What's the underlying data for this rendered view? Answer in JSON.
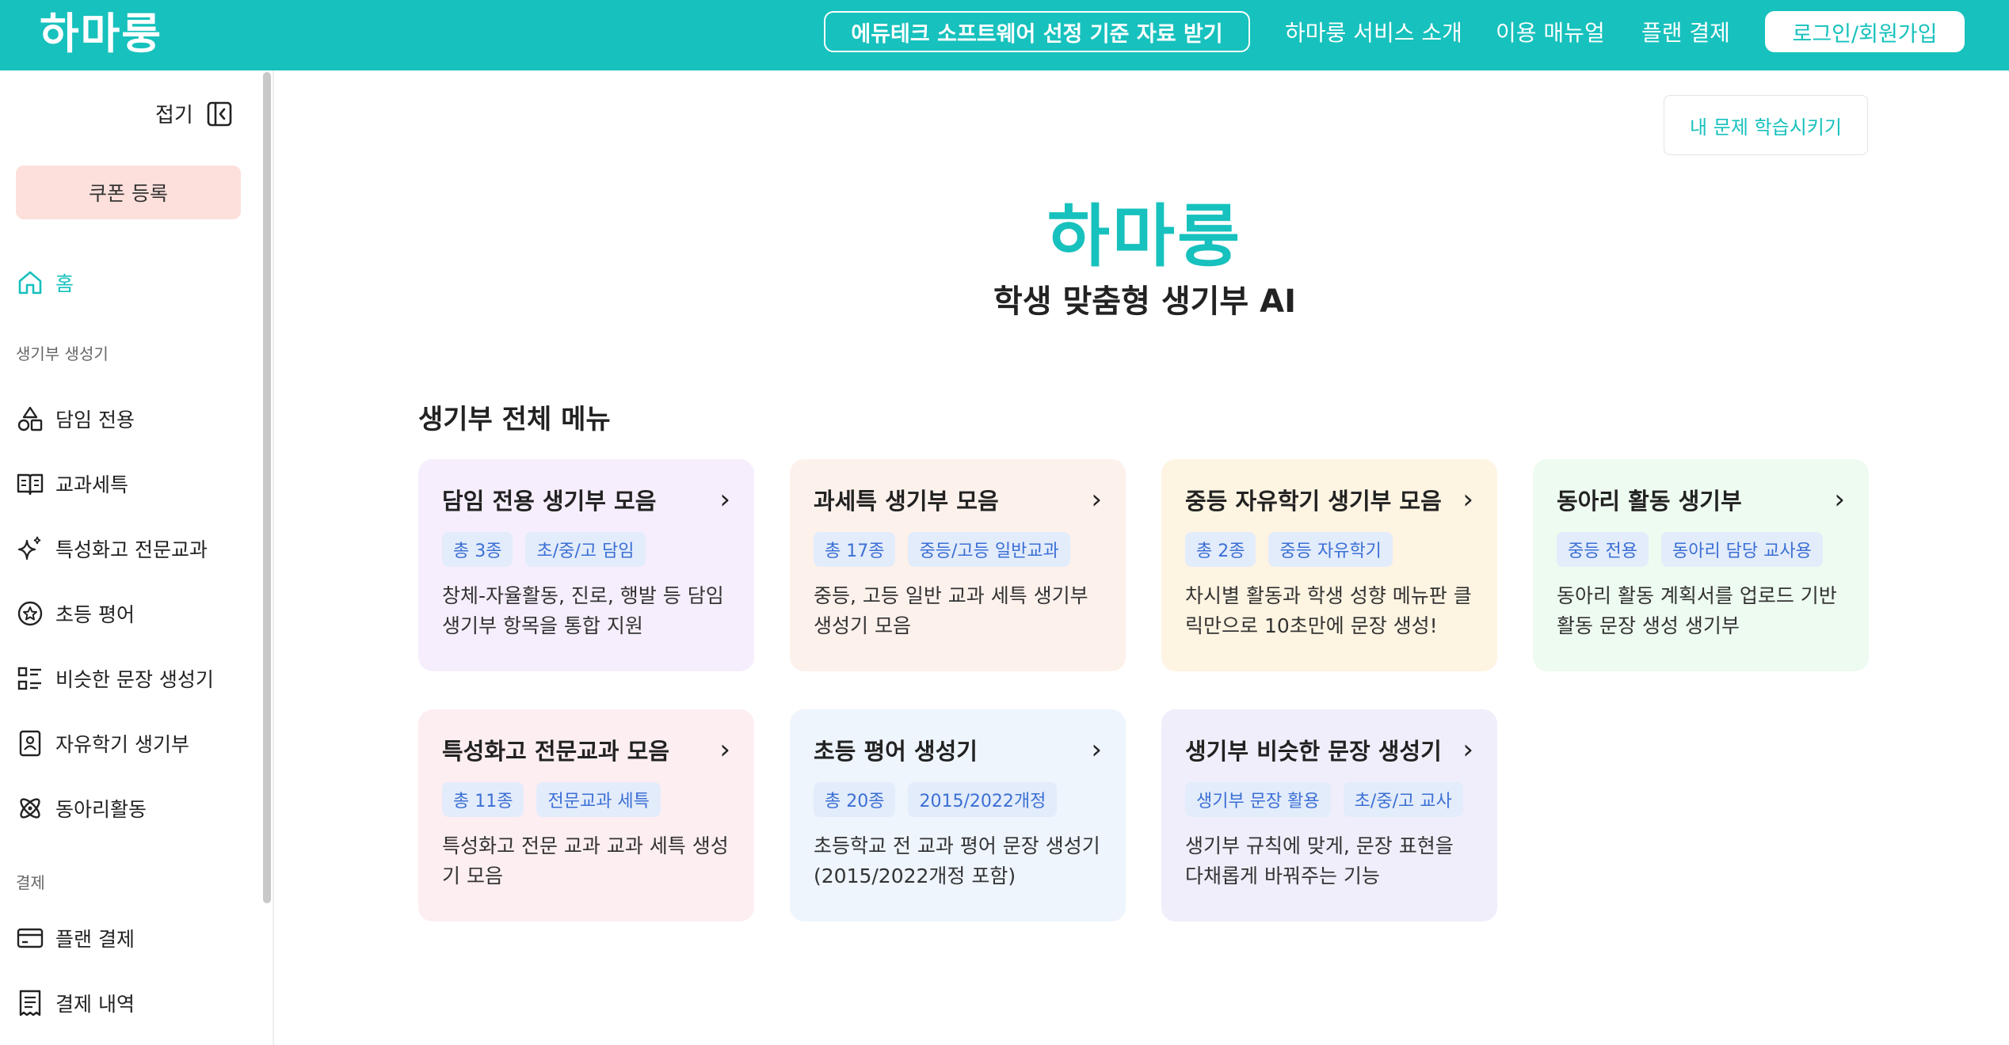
{
  "header": {
    "logo": "하마룽",
    "promo": "에듀테크 소프트웨어 선정 기준 자료 받기",
    "nav": [
      "하마룽 서비스 소개",
      "이용 매뉴얼",
      "플랜 결제"
    ],
    "login": "로그인/회원가입"
  },
  "sidebar": {
    "collapse": "접기",
    "coupon": "쿠폰 등록",
    "home": "홈",
    "section1": "생기부 생성기",
    "items": [
      "담임 전용",
      "교과세특",
      "특성화고 전문교과",
      "초등 평어",
      "비슷한 문장 생성기",
      "자유학기 생기부",
      "동아리활동"
    ],
    "section2": "결제",
    "pay_items": [
      "플랜 결제",
      "결제 내역"
    ]
  },
  "main": {
    "learn_button": "내 문제 학습시키기",
    "hero_logo": "하마룽",
    "hero_sub": "학생 맞춤형 생기부 AI",
    "section_title": "생기부 전체 메뉴",
    "cards": [
      {
        "title": "담임 전용 생기부 모음",
        "tags": [
          "총 3종",
          "초/중/고 담임"
        ],
        "desc": "창체-자율활동, 진로, 행발 등 담임 생기부 항목을 통합 지원"
      },
      {
        "title": "과세특 생기부 모음",
        "tags": [
          "총 17종",
          "중등/고등 일반교과"
        ],
        "desc": "중등, 고등 일반 교과 세특 생기부 생성기 모음"
      },
      {
        "title": "중등 자유학기 생기부 모음",
        "tags": [
          "총 2종",
          "중등 자유학기"
        ],
        "desc": "차시별 활동과 학생 성향 메뉴판 클릭만으로 10초만에 문장 생성!"
      },
      {
        "title": "동아리 활동 생기부",
        "tags": [
          "중등 전용",
          "동아리 담당 교사용"
        ],
        "desc": "동아리 활동 계획서를 업로드 기반 활동 문장 생성 생기부"
      },
      {
        "title": "특성화고 전문교과 모음",
        "tags": [
          "총 11종",
          "전문교과 세특"
        ],
        "desc": "특성화고 전문 교과 교과 세특 생성기 모음"
      },
      {
        "title": "초등 평어 생성기",
        "tags": [
          "총 20종",
          "2015/2022개정"
        ],
        "desc": "초등학교 전 교과 평어 문장 생성기 (2015/2022개정 포함)"
      },
      {
        "title": "생기부 비슷한 문장 생성기",
        "tags": [
          "생기부 문장 활용",
          "초/중/고 교사"
        ],
        "desc": "생기부 규칙에 맞게, 문장 표현을 다채롭게 바꿔주는 기능"
      }
    ]
  },
  "colors": {
    "brand": "#17c1bd",
    "coupon_bg": "#fde0dc",
    "card_bgs": [
      "#f6eefc",
      "#fdf1ec",
      "#fef4e2",
      "#eefbf0",
      "#fdeef1",
      "#eef5fd",
      "#f0eefb"
    ],
    "tag_bg": "#e3ecfb",
    "tag_text": "#3b6fd4"
  }
}
